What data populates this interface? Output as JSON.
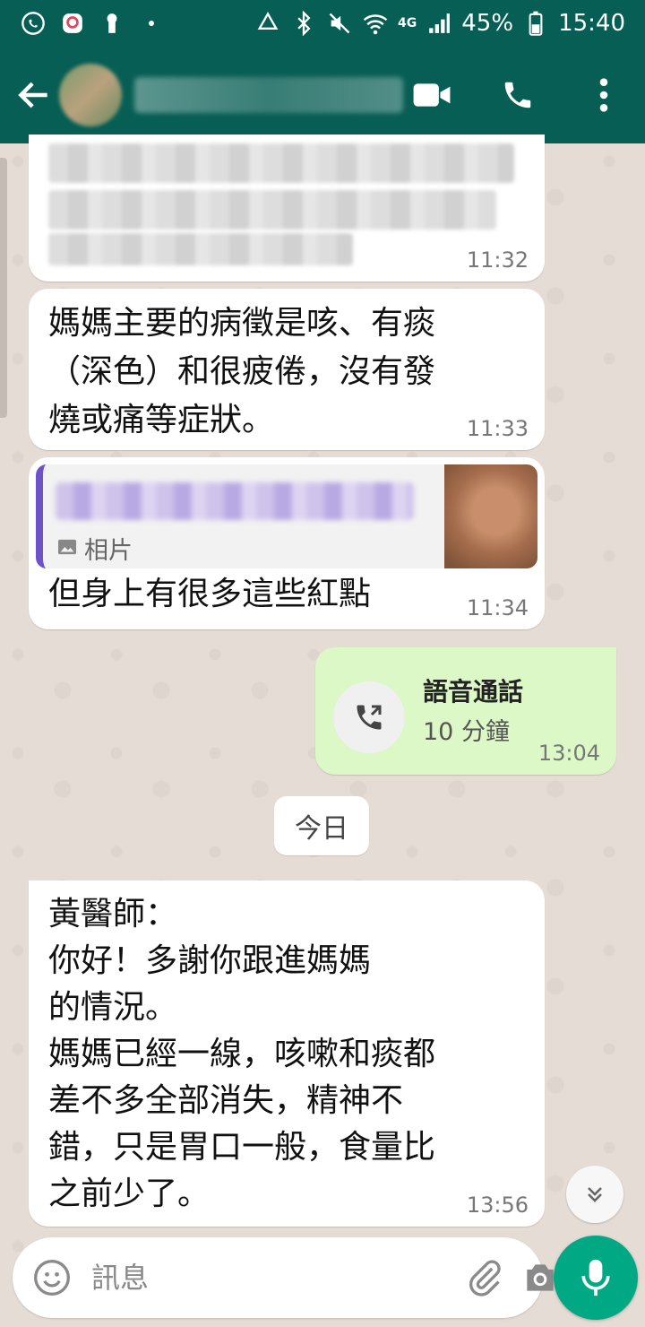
{
  "status_bar": {
    "battery": "45%",
    "network": "4G",
    "clock": "15:40"
  },
  "app_bar": {
    "contact_name": "",
    "icons": [
      "back-arrow-icon",
      "video-call-icon",
      "voice-call-icon",
      "more-vert-icon"
    ]
  },
  "messages": [
    {
      "type": "incoming",
      "text": "",
      "time": "11:32"
    },
    {
      "type": "incoming",
      "text": "媽媽主要的病徵是咳、有痰\n（深色）和很疲倦，沒有發\n燒或痛等症狀。",
      "time": "11:33"
    },
    {
      "type": "incoming",
      "quote_label": "相片",
      "text": "但身上有很多這些紅點",
      "time": "11:34"
    },
    {
      "type": "outgoing-call",
      "title": "語音通話",
      "duration": "10 分鐘",
      "time": "13:04"
    },
    {
      "type": "incoming",
      "text": "黃醫師：\n你好！多謝你跟進媽媽\n的情況。\n媽媽已經一線，咳嗽和痰都\n差不多全部消失，精神不\n錯，只是胃口一般，食量比\n之前少了。",
      "time": "13:56"
    }
  ],
  "date_separator": "今日",
  "composer": {
    "placeholder": "訊息"
  },
  "colors": {
    "header": "#075e54",
    "outgoing_bubble": "#dcf8c6",
    "mic_button": "#00a884",
    "quote_bar": "#6f51c9"
  }
}
